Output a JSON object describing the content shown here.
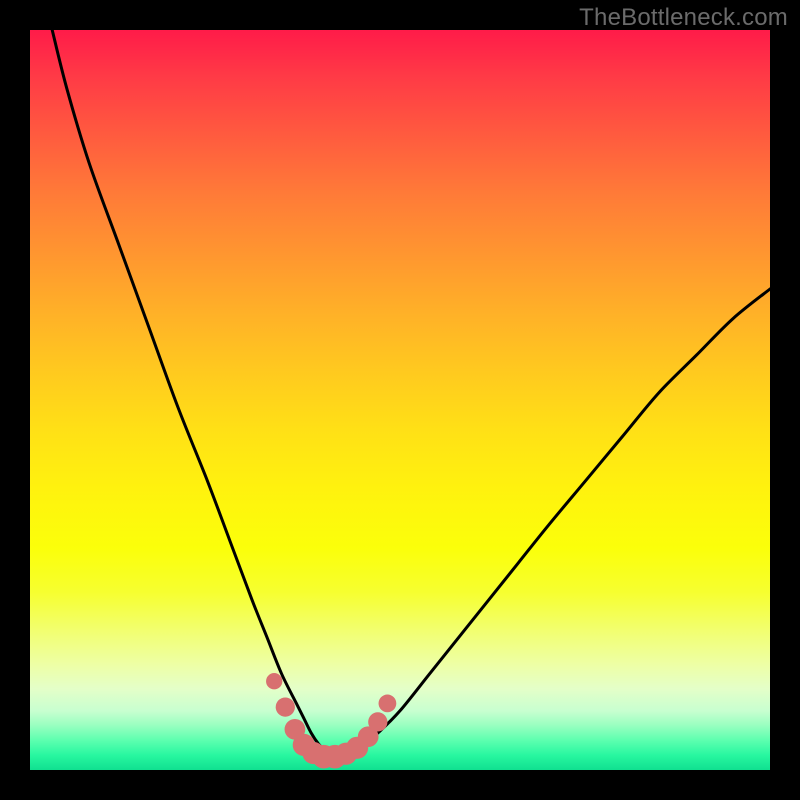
{
  "watermark": {
    "text": "TheBottleneck.com"
  },
  "chart_data": {
    "type": "line",
    "title": "",
    "xlabel": "",
    "ylabel": "",
    "xlim": [
      0,
      100
    ],
    "ylim": [
      0,
      100
    ],
    "series": [
      {
        "name": "bottleneck-curve",
        "x": [
          3,
          5,
          8,
          12,
          16,
          20,
          24,
          27,
          30,
          32,
          34,
          36,
          37,
          38,
          39,
          40,
          41,
          42,
          43,
          44,
          45,
          47,
          50,
          54,
          58,
          62,
          66,
          70,
          75,
          80,
          85,
          90,
          95,
          100
        ],
        "y": [
          100,
          92,
          82,
          71,
          60,
          49,
          39,
          31,
          23,
          18,
          13,
          9,
          7,
          5,
          3.5,
          2.5,
          2,
          2,
          2.3,
          2.8,
          3.5,
          5,
          8,
          13,
          18,
          23,
          28,
          33,
          39,
          45,
          51,
          56,
          61,
          65
        ],
        "stroke": "#000000",
        "stroke_width": 3
      }
    ],
    "markers": [
      {
        "name": "marker-dot",
        "cx": 33.0,
        "cy": 12.0,
        "r": 1.1,
        "fill": "#d87070"
      },
      {
        "name": "marker-dot",
        "cx": 34.5,
        "cy": 8.5,
        "r": 1.3,
        "fill": "#d87070"
      },
      {
        "name": "marker-dot",
        "cx": 35.8,
        "cy": 5.5,
        "r": 1.4,
        "fill": "#d87070"
      },
      {
        "name": "marker-dot",
        "cx": 37.0,
        "cy": 3.4,
        "r": 1.5,
        "fill": "#d87070"
      },
      {
        "name": "marker-dot",
        "cx": 38.3,
        "cy": 2.3,
        "r": 1.5,
        "fill": "#d87070"
      },
      {
        "name": "marker-dot",
        "cx": 39.7,
        "cy": 1.8,
        "r": 1.6,
        "fill": "#d87070"
      },
      {
        "name": "marker-dot",
        "cx": 41.2,
        "cy": 1.8,
        "r": 1.6,
        "fill": "#d87070"
      },
      {
        "name": "marker-dot",
        "cx": 42.7,
        "cy": 2.2,
        "r": 1.5,
        "fill": "#d87070"
      },
      {
        "name": "marker-dot",
        "cx": 44.2,
        "cy": 3.0,
        "r": 1.5,
        "fill": "#d87070"
      },
      {
        "name": "marker-dot",
        "cx": 45.7,
        "cy": 4.5,
        "r": 1.4,
        "fill": "#d87070"
      },
      {
        "name": "marker-dot",
        "cx": 47.0,
        "cy": 6.5,
        "r": 1.3,
        "fill": "#d87070"
      },
      {
        "name": "marker-dot",
        "cx": 48.3,
        "cy": 9.0,
        "r": 1.2,
        "fill": "#d87070"
      }
    ]
  }
}
